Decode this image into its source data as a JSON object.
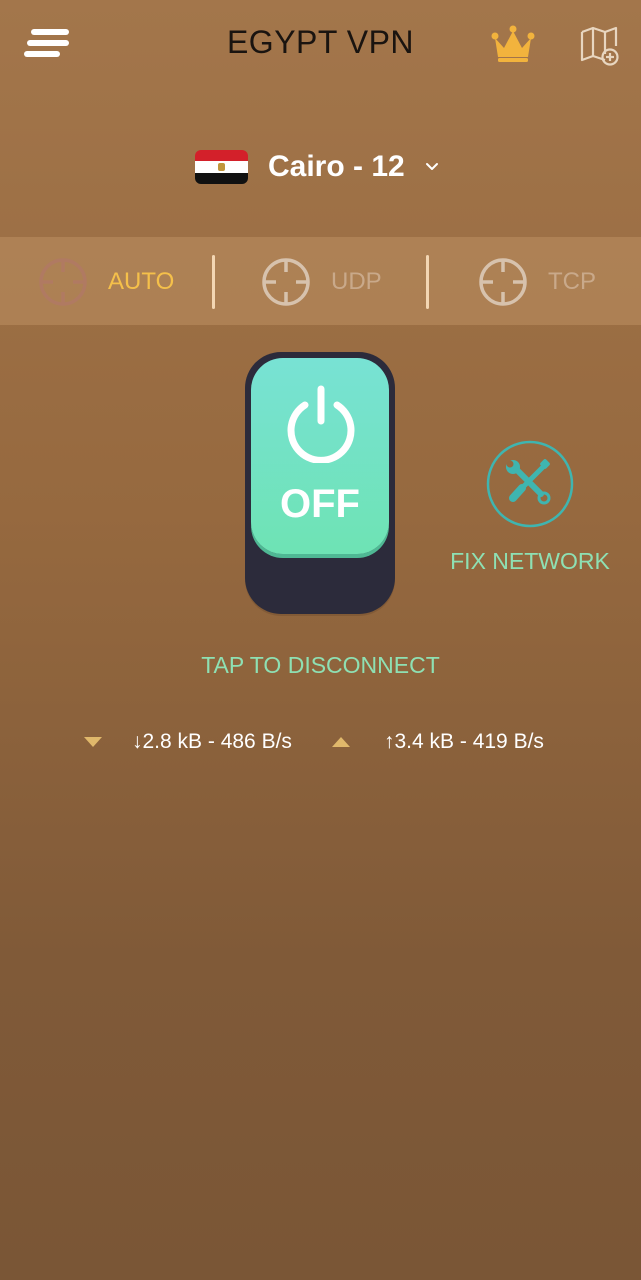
{
  "header": {
    "title": "EGYPT VPN",
    "menu_icon": "hamburger-menu-icon",
    "premium_icon": "crown-icon",
    "map_icon": "map-add-icon"
  },
  "server": {
    "country_flag": "egypt-flag-icon",
    "name": "Cairo - 12",
    "dropdown_icon": "chevron-down-icon"
  },
  "protocols": [
    {
      "label": "AUTO",
      "selected": true
    },
    {
      "label": "UDP",
      "selected": false
    },
    {
      "label": "TCP",
      "selected": false
    }
  ],
  "toggle": {
    "state": "OFF",
    "icon": "power-icon"
  },
  "fix_network": {
    "label": "FIX NETWORK",
    "icon": "tools-icon"
  },
  "hint": "TAP TO DISCONNECT",
  "traffic": {
    "download": "↓2.8 kB - 486 B/s",
    "upload": "↑3.4 kB - 419 B/s"
  },
  "colors": {
    "accent_green": "#8ee0b3",
    "selected_protocol": "#f5c04a",
    "background": "#96693f"
  }
}
